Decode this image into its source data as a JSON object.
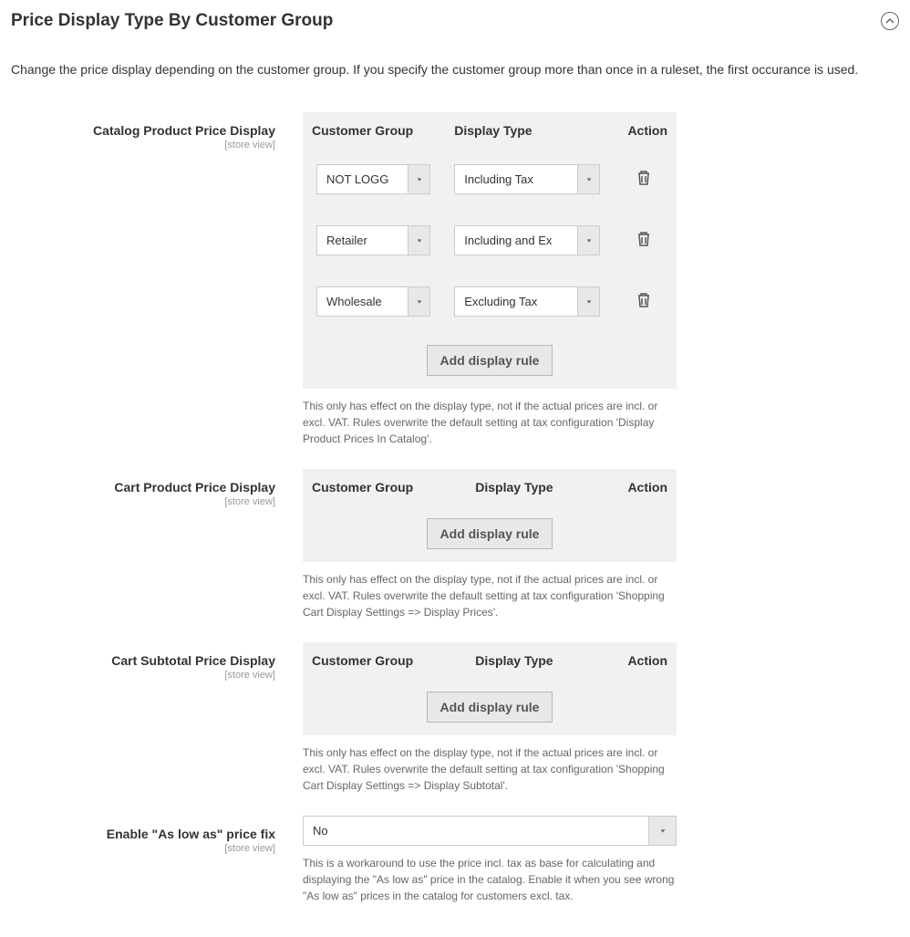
{
  "section": {
    "title": "Price Display Type By Customer Group",
    "description": "Change the price display depending on the customer group. If you specify the customer group more than once in a ruleset, the first occurance is used."
  },
  "catalog": {
    "label": "Catalog Product Price Display",
    "scope": "[store view]",
    "headers": {
      "group": "Customer Group",
      "type": "Display Type",
      "action": "Action"
    },
    "rules": [
      {
        "group": "NOT LOGG",
        "type": "Including Tax"
      },
      {
        "group": "Retailer",
        "type": "Including and Ex"
      },
      {
        "group": "Wholesale",
        "type": "Excluding Tax"
      }
    ],
    "add_label": "Add display rule",
    "help": "This only has effect on the display type, not if the actual prices are incl. or excl. VAT. Rules overwrite the default setting at tax configuration 'Display Product Prices In Catalog'."
  },
  "cart": {
    "label": "Cart Product Price Display",
    "scope": "[store view]",
    "headers": {
      "group": "Customer Group",
      "type": "Display Type",
      "action": "Action"
    },
    "add_label": "Add display rule",
    "help": "This only has effect on the display type, not if the actual prices are incl. or excl. VAT. Rules overwrite the default setting at tax configuration 'Shopping Cart Display Settings => Display Prices'."
  },
  "subtotal": {
    "label": "Cart Subtotal Price Display",
    "scope": "[store view]",
    "headers": {
      "group": "Customer Group",
      "type": "Display Type",
      "action": "Action"
    },
    "add_label": "Add display rule",
    "help": "This only has effect on the display type, not if the actual prices are incl. or excl. VAT. Rules overwrite the default setting at tax configuration 'Shopping Cart Display Settings => Display Subtotal'."
  },
  "aslowas": {
    "label": "Enable \"As low as\" price fix",
    "scope": "[store view]",
    "value": "No",
    "help": "This is a workaround to use the price incl. tax as base for calculating and displaying the \"As low as\" price in the catalog. Enable it when you see wrong \"As low as\" prices in the catalog for customers excl. tax."
  }
}
